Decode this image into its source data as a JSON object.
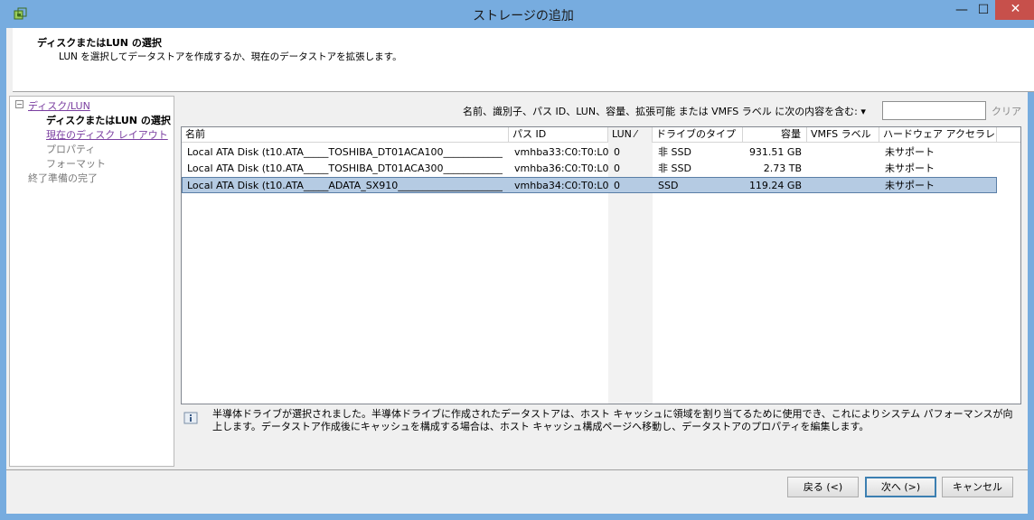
{
  "window": {
    "title": "ストレージの追加",
    "controls": {
      "minimize": "—",
      "maximize": "☐",
      "close": "✕"
    }
  },
  "header": {
    "title": "ディスクまたはLUN の選択",
    "subtitle": "LUN を選択してデータストアを作成するか、現在のデータストアを拡張します。"
  },
  "nav": {
    "root": "ディスク/LUN",
    "items": [
      {
        "label": "ディスクまたはLUN の選択",
        "state": "current"
      },
      {
        "label": "現在のディスク レイアウト",
        "state": "link"
      },
      {
        "label": "プロパティ",
        "state": "disabled"
      },
      {
        "label": "フォーマット",
        "state": "disabled"
      }
    ],
    "finish": "終了準備の完了"
  },
  "filter": {
    "label": "名前、識別子、パス ID、LUN、容量、拡張可能 または VMFS ラベル に次の内容を含む: ▾",
    "value": "",
    "clear": "クリア"
  },
  "table": {
    "columns": [
      "名前",
      "パス ID",
      "LUN ⁄",
      "ドライブのタイプ",
      "容量",
      "VMFS ラベル",
      "ハードウェア アクセラレ..."
    ],
    "rows": [
      {
        "name": "Local ATA Disk (t10.ATA_____TOSHIBA_DT01ACA100____________...",
        "path": "vmhba33:C0:T0:L0",
        "lun": "0",
        "drive_type": "非 SSD",
        "capacity": "931.51 GB",
        "vmfs": "",
        "hw_accel": "未サポート",
        "selected": false
      },
      {
        "name": "Local ATA Disk (t10.ATA_____TOSHIBA_DT01ACA300____________...",
        "path": "vmhba36:C0:T0:L0",
        "lun": "0",
        "drive_type": "非 SSD",
        "capacity": "2.73 TB",
        "vmfs": "",
        "hw_accel": "未サポート",
        "selected": false
      },
      {
        "name": "Local ATA Disk (t10.ATA_____ADATA_SX910________________________...",
        "path": "vmhba34:C0:T0:L0",
        "lun": "0",
        "drive_type": "SSD",
        "capacity": "119.24 GB",
        "vmfs": "",
        "hw_accel": "未サポート",
        "selected": true
      }
    ]
  },
  "info": {
    "text": "半導体ドライブが選択されました。半導体ドライブに作成されたデータストアは、ホスト キャッシュに領域を割り当てるために使用でき、これによりシステム パフォーマンスが向上します。データストア作成後にキャッシュを構成する場合は、ホスト キャッシュ構成ページへ移動し、データストアのプロパティを編集します。"
  },
  "buttons": {
    "back": "戻る (<)",
    "next": "次へ (>)",
    "cancel": "キャンセル"
  },
  "colors": {
    "titlebar": "#77acdf",
    "close": "#c7504b",
    "selection": "#b5cbe3",
    "link": "#7a3ea0"
  }
}
